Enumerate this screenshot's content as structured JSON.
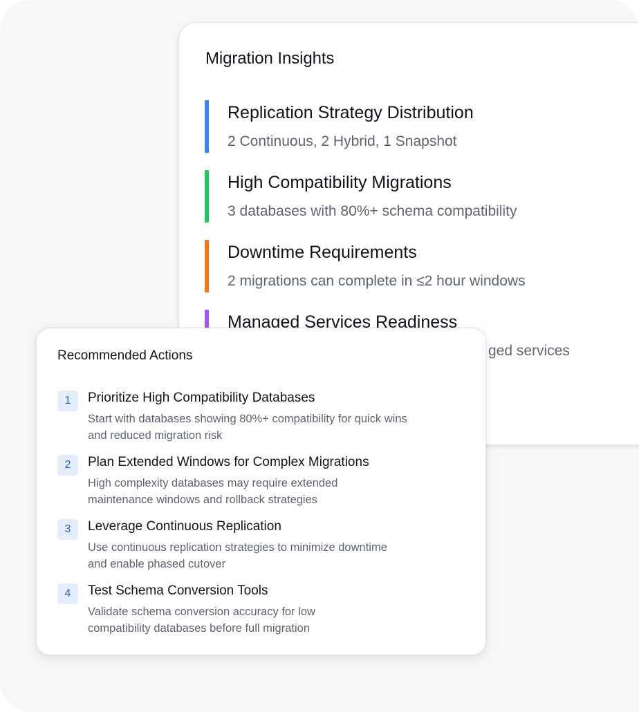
{
  "insights": {
    "title": "Migration Insights",
    "items": [
      {
        "title": "Replication Strategy Distribution",
        "description": "2 Continuous, 2 Hybrid, 1 Snapshot",
        "color": "#3b82f6"
      },
      {
        "title": "High Compatibility Migrations",
        "description": "3 databases with 80%+ schema compatibility",
        "color": "#22c55e"
      },
      {
        "title": "Downtime Requirements",
        "description": "2 migrations can complete in ≤2 hour windows",
        "color": "#f97316"
      },
      {
        "title": "Managed Services Readiness",
        "description": "ged services",
        "color": "#a855f7"
      }
    ]
  },
  "actions": {
    "title": "Recommended Actions",
    "items": [
      {
        "number": "1",
        "title": "Prioritize High Compatibility Databases",
        "description_lines": [
          "Start with databases showing 80%+ compatibility for quick wins",
          "and reduced migration risk"
        ]
      },
      {
        "number": "2",
        "title": "Plan Extended Windows for Complex Migrations",
        "description_lines": [
          "High complexity databases may require extended",
          "maintenance windows and rollback strategies"
        ]
      },
      {
        "number": "3",
        "title": "Leverage Continuous Replication",
        "description_lines": [
          "Use continuous replication strategies to minimize downtime",
          "and enable phased cutover"
        ]
      },
      {
        "number": "4",
        "title": "Test Schema Conversion Tools",
        "description_lines": [
          "Validate schema conversion accuracy for low",
          "compatibility databases before full migration"
        ]
      }
    ],
    "badge_bg": "#e4edfb",
    "badge_fg": "#2a5bd7"
  }
}
